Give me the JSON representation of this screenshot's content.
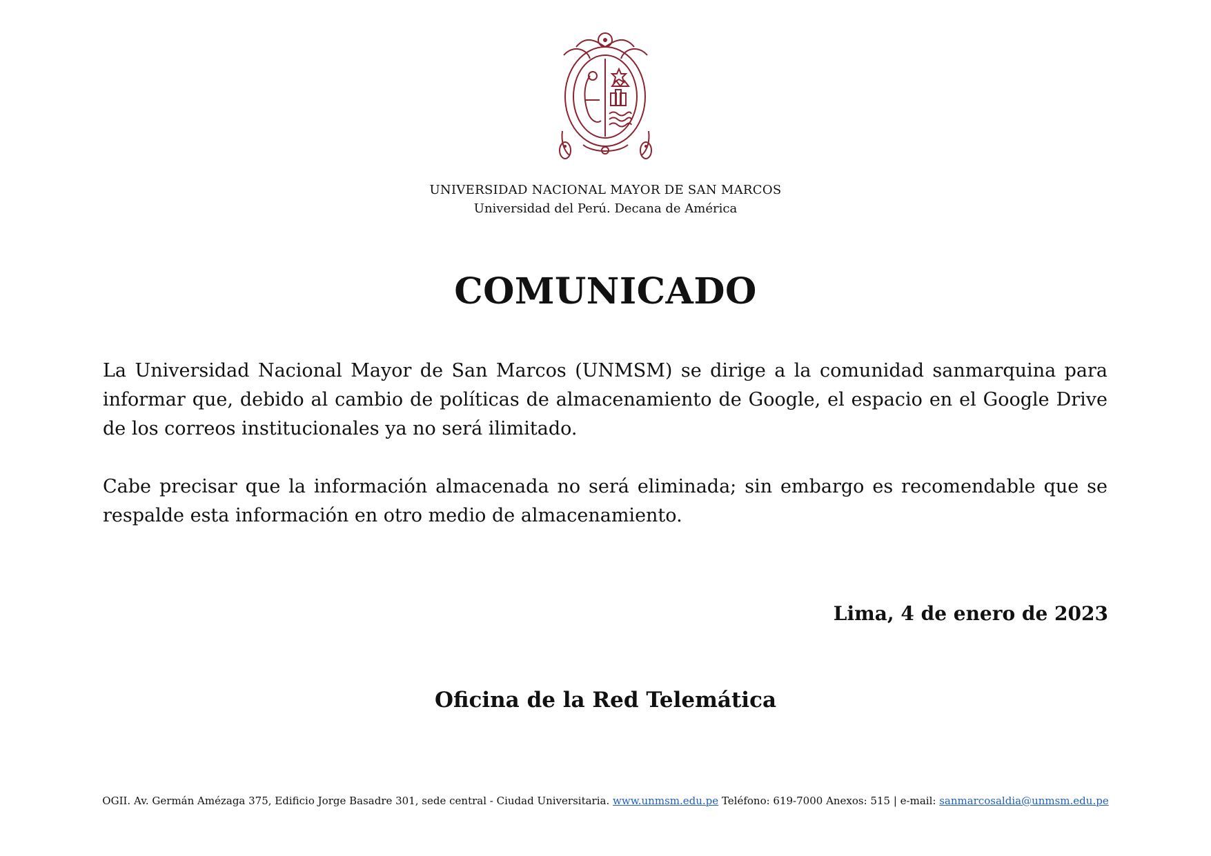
{
  "seal": {
    "icon": "university-seal-icon",
    "color": "#8b2331"
  },
  "header": {
    "university": "UNIVERSIDAD NACIONAL MAYOR DE SAN MARCOS",
    "subtitle": "Universidad del Perú. Decana de América"
  },
  "title": "COMUNICADO",
  "body": {
    "paragraph1": "La Universidad Nacional Mayor de San Marcos (UNMSM) se dirige a la comunidad sanmarquina para informar que, debido al cambio de políticas de almacenamiento de Google, el espacio en el Google Drive de los correos institucionales ya no será ilimitado.",
    "paragraph2": "Cabe precisar que la información almacenada no será eliminada; sin embargo es recomendable que se respalde esta información en otro medio de almacenamiento."
  },
  "date": "Lima, 4 de enero de 2023",
  "office": "Oficina de la Red Telemática",
  "footer": {
    "address": "OGII. Av. Germán Amézaga 375, Edificio Jorge Basadre 301, sede central - Ciudad Universitaria.",
    "website": "www.unmsm.edu.pe",
    "phone": "Teléfono: 619-7000 Anexos: 515 | e-mail:",
    "email": "sanmarcosaldia@unmsm.edu.pe",
    "link_color": "#1f5fbf"
  }
}
